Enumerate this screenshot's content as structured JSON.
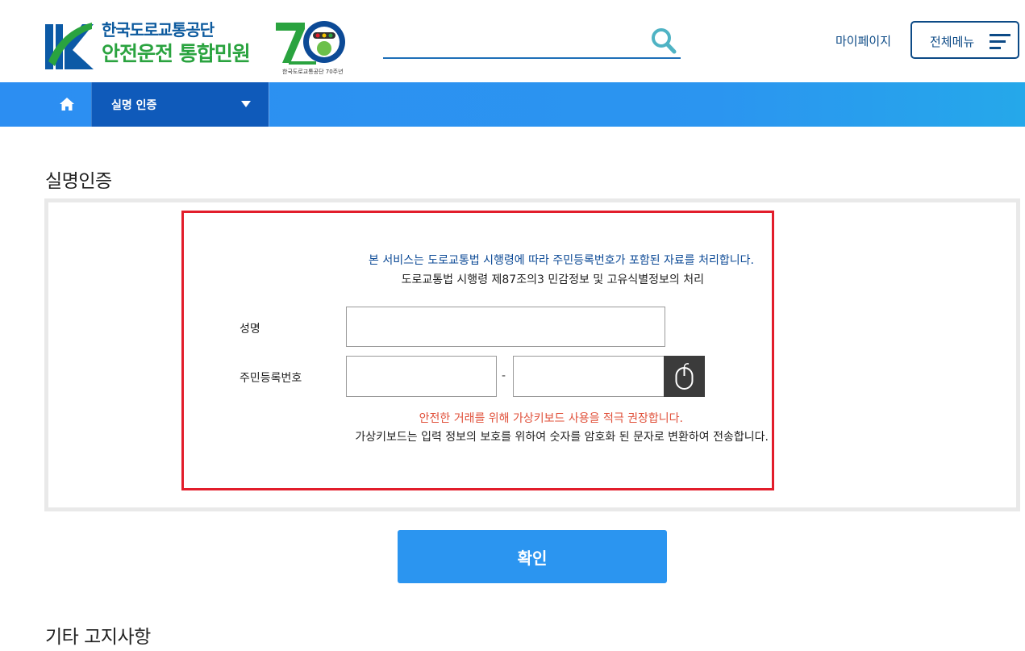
{
  "header": {
    "logo_line1": "한국도로교통공단",
    "logo_line2": "안전운전 통합민원",
    "anniversary_caption": "한국도로교통공단 70주년",
    "search_placeholder": "",
    "mypage_label": "마이페이지",
    "allmenu_label": "전체메뉴"
  },
  "nav": {
    "home_icon": "home-icon",
    "selected_menu": "실명 인증"
  },
  "main": {
    "page_title": "실명인증",
    "notice_line1": "본 서비스는 도로교통법 시행령에 따라 주민등록번호가 포함된 자료를 처리합니다.",
    "notice_line2": "도로교통법 시행령 제87조의3 민감정보 및 고유식별정보의 처리",
    "name_label": "성명",
    "name_value": "",
    "rrn_label": "주민등록번호",
    "rrn_front_value": "",
    "rrn_separator": "-",
    "rrn_back_value": "",
    "virtual_keyboard_icon": "mouse-icon",
    "warning_line1": "안전한 거래를 위해 가상키보드 사용을 적극 권장합니다.",
    "warning_line2": "가상키보드는 입력 정보의 보호를 위하여 숫자를 암호화 된 문자로 변환하여 전송합니다.",
    "confirm_label": "확인",
    "etc_title": "기타 고지사항"
  },
  "colors": {
    "brand_navy": "#0c4a86",
    "brand_green": "#2aa33f",
    "nav_blue": "#2b95f0",
    "nav_selected": "#0f5aba",
    "alert_red": "#e21d2b",
    "warning_text": "#e0503a"
  }
}
